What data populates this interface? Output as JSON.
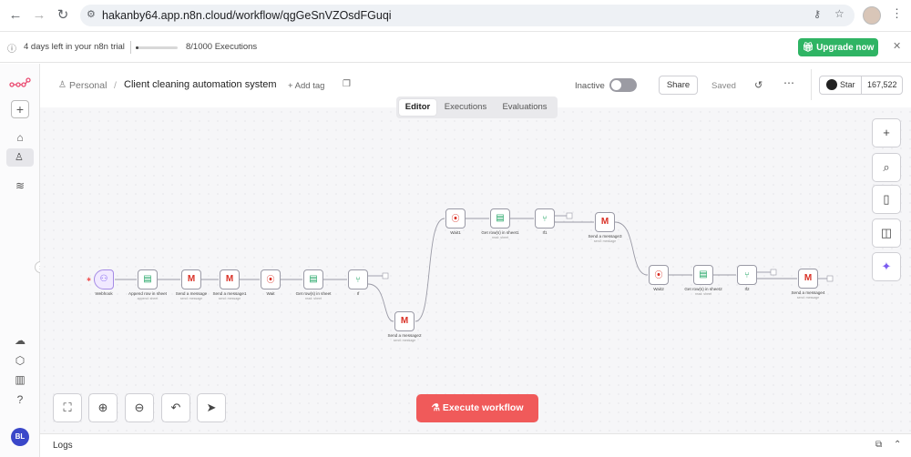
{
  "browser": {
    "url": "hakanby64.app.n8n.cloud/workflow/qgGeSnVZOsdFGuqi"
  },
  "trial": {
    "days_left": "4 days left in your n8n trial",
    "executions": "8/1000 Executions",
    "executions_fraction": 0.008,
    "upgrade_label": "Upgrade now"
  },
  "header": {
    "breadcrumb_project": "Personal",
    "breadcrumb_sep": "/",
    "workflow_name": "Client cleaning automation system",
    "add_tag": "+ Add tag",
    "status": "Inactive",
    "share_label": "Share",
    "saved_label": "Saved",
    "star_label": "Star",
    "star_count": "167,522"
  },
  "tabs": [
    {
      "label": "Editor",
      "active": true
    },
    {
      "label": "Executions",
      "active": false
    },
    {
      "label": "Evaluations",
      "active": false
    }
  ],
  "nodes": [
    {
      "label": "Webhook",
      "sub": ""
    },
    {
      "label": "Append row in sheet",
      "sub": "append: sheet"
    },
    {
      "label": "Send a message",
      "sub": "send: message"
    },
    {
      "label": "Send a message1",
      "sub": "send: message"
    },
    {
      "label": "Wait",
      "sub": ""
    },
    {
      "label": "Get row(s) in sheet",
      "sub": "read: sheet"
    },
    {
      "label": "If",
      "sub": ""
    },
    {
      "label": "Send a message2",
      "sub": "send: message"
    },
    {
      "label": "Wait1",
      "sub": ""
    },
    {
      "label": "Get row(s) in sheet1",
      "sub": "read: sheet"
    },
    {
      "label": "If1",
      "sub": ""
    },
    {
      "label": "Send a message3",
      "sub": "send: message"
    },
    {
      "label": "Wait2",
      "sub": ""
    },
    {
      "label": "Get row(s) in sheet2",
      "sub": "read: sheet"
    },
    {
      "label": "If2",
      "sub": ""
    },
    {
      "label": "Send a message4",
      "sub": "send: message"
    }
  ],
  "execute_label": "Execute workflow",
  "logs_label": "Logs",
  "avatar_initials": "BL",
  "colors": {
    "accent": "#f05a5a",
    "upgrade": "#2fb464"
  }
}
